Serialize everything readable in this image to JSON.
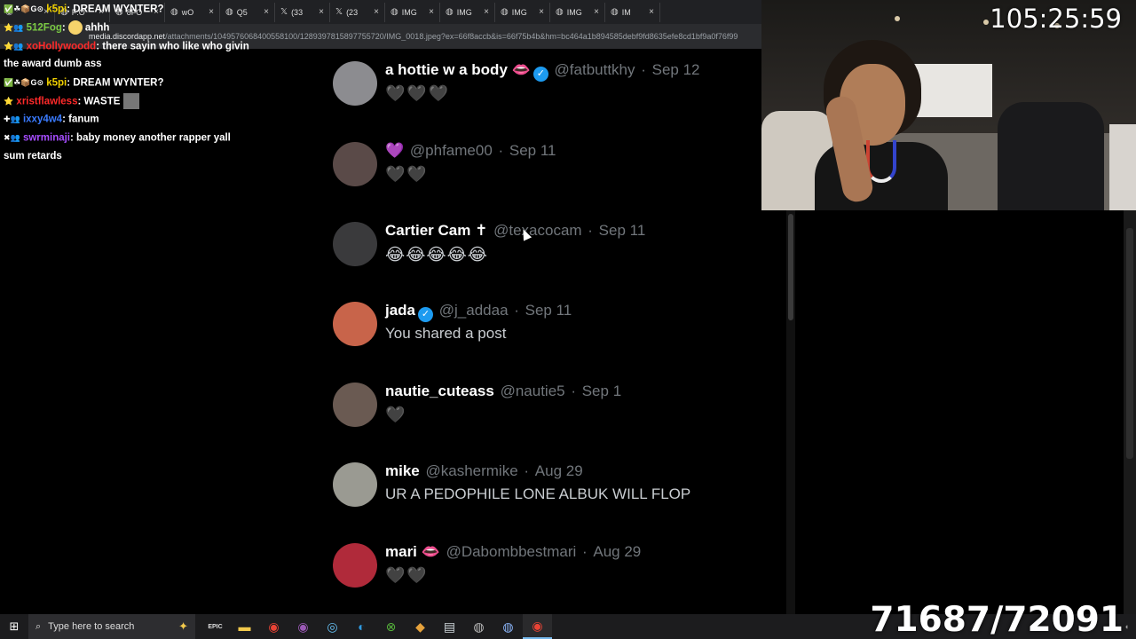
{
  "browser": {
    "tabs": [
      {
        "label": "",
        "icon": "discord-icon"
      },
      {
        "label": "F:O",
        "icon": "globe-icon"
      },
      {
        "label": "8FO",
        "icon": "globe-icon"
      },
      {
        "label": "wO",
        "icon": "globe-icon"
      },
      {
        "label": "Q5",
        "icon": "globe-icon"
      },
      {
        "label": "(33",
        "icon": "x-logo-icon"
      },
      {
        "label": "(23",
        "icon": "x-logo-icon"
      },
      {
        "label": "IMG",
        "icon": "globe-icon"
      },
      {
        "label": "IMG",
        "icon": "globe-icon"
      },
      {
        "label": "IMG",
        "icon": "globe-icon"
      },
      {
        "label": "IMG",
        "icon": "globe-icon"
      },
      {
        "label": "IM",
        "icon": "globe-icon"
      }
    ],
    "url_host": "media.discordapp.net",
    "url_path": "/attachments/1049576068400558100/1289397815897755720/IMG_0018.jpeg?ex=66f8accb&is=66f75b4b&hm=bc464a1b894585debf9fd8635efe8cd1bf9a0f76f99"
  },
  "chat": [
    {
      "badges": "✅☘📦G⊙",
      "user": "k5pi",
      "user_color": "#f0d000",
      "text": "DREAM WYNTER?"
    },
    {
      "badges": "⭐👥",
      "user": "512Fog",
      "user_color": "#7ac943",
      "text": "ahhh",
      "emote": true
    },
    {
      "badges": "⭐👥",
      "user": "xoHollywoodd",
      "user_color": "#ff2a2a",
      "text": "there sayin who like who givin"
    },
    {
      "badges": "",
      "user": "",
      "user_color": "#ffffff",
      "text": "the award dumb ass"
    },
    {
      "badges": "✅☘📦G⊙",
      "user": "k5pi",
      "user_color": "#f0d000",
      "text": "DREAM WYNTER?"
    },
    {
      "badges": "⭐",
      "user": "xristflawless",
      "user_color": "#ff2a2a",
      "text": "WASTE",
      "emote": true
    },
    {
      "badges": "✚👥",
      "user": "ixxy4w4",
      "user_color": "#3a7bff",
      "text": "fanum"
    },
    {
      "badges": "✖👥",
      "user": "swrminaji",
      "user_color": "#a64dff",
      "text": "baby money another rapper yall"
    },
    {
      "badges": "",
      "user": "",
      "user_color": "#ffffff",
      "text": "sum retards"
    }
  ],
  "posts": [
    {
      "name": "a hottie w a body",
      "emoji": "👄",
      "verified": true,
      "handle": "@fatbuttkhy",
      "date": "Sep 12",
      "body": "🖤🖤🖤",
      "body_type": "hearts",
      "avatar_color": "#8c8c90"
    },
    {
      "name": "",
      "emoji": "💜",
      "verified": false,
      "handle": "@phfame00",
      "date": "Sep 11",
      "body": "🖤🖤",
      "body_type": "hearts",
      "avatar_color": "#5a4a48"
    },
    {
      "name": "Cartier Cam",
      "emoji": "✝",
      "verified": false,
      "handle": "@texacocam",
      "date": "Sep 11",
      "body": "😂😂😂😂😂",
      "body_type": "emojis",
      "avatar_color": "#3a3a3c"
    },
    {
      "name": "jada",
      "emoji": "",
      "verified": true,
      "handle": "@j_addaa",
      "date": "Sep 11",
      "body": "You shared a post",
      "body_type": "text",
      "avatar_color": "#c8644a"
    },
    {
      "name": "nautie_cuteass",
      "emoji": "",
      "verified": false,
      "handle": "@nautie5",
      "date": "Sep 1",
      "body": "🖤",
      "body_type": "hearts",
      "avatar_color": "#6a5a52"
    },
    {
      "name": "mike",
      "emoji": "",
      "verified": false,
      "handle": "@kashermike",
      "date": "Aug 29",
      "body": "UR A PEDOPHILE LONE ALBUK WILL FLOP",
      "body_type": "text",
      "avatar_color": "#9a9a92"
    },
    {
      "name": "mari",
      "emoji": "👄",
      "verified": false,
      "handle": "@Dabombbestmari",
      "date": "Aug 29",
      "body": "🖤🖤",
      "body_type": "hearts",
      "avatar_color": "#b02a3a"
    }
  ],
  "overlay": {
    "timer": "105:25:59",
    "counter": "71687/72091"
  },
  "taskbar": {
    "search_placeholder": "Type here to search",
    "apps": [
      "epic-games-icon",
      "file-explorer-icon",
      "chrome-icon",
      "chrome-profile-icon",
      "steam-icon",
      "edge-icon",
      "xbox-icon",
      "unknown-app-icon",
      "notepad-icon",
      "obs-icon",
      "obs-alt-icon",
      "chrome-active-icon"
    ]
  },
  "colors": {
    "verified": "#1d9bf0",
    "handle": "#71767b"
  }
}
